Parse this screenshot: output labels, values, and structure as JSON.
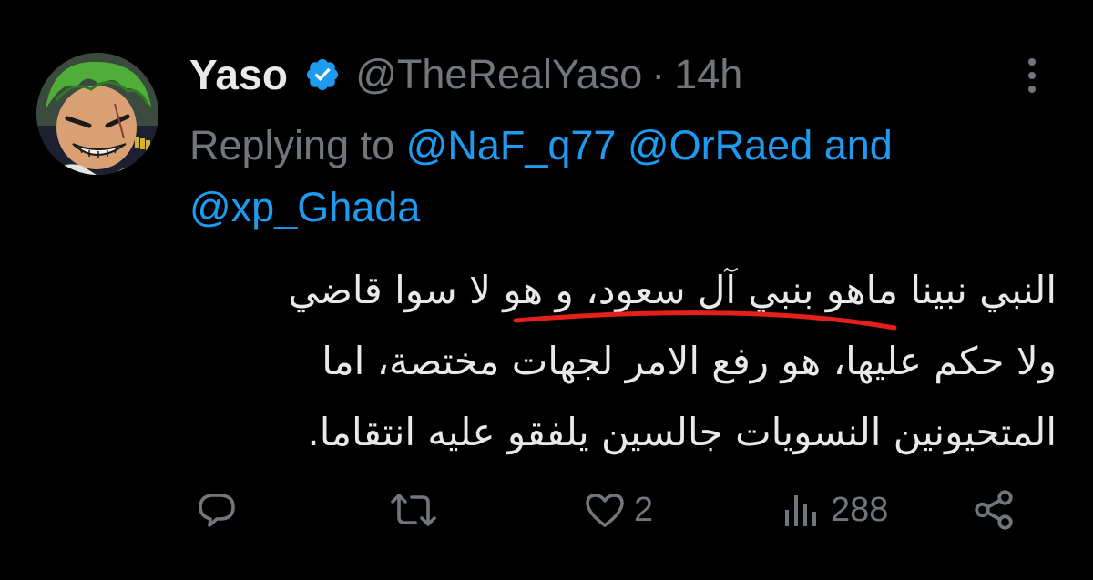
{
  "tweet": {
    "author": {
      "display_name": "Yaso",
      "handle": "@TheRealYaso",
      "time": "14h",
      "separator": "·",
      "verified": true,
      "avatar_icon": "avatar-anime-character"
    },
    "reply": {
      "prefix": "Replying to",
      "mention_1": "@NaF_q77",
      "mention_2": "@OrRaed",
      "and": "and",
      "mention_3": "@xp_Ghada"
    },
    "body": {
      "line_1": "النبي نبينا ماهو بنبي آل سعود، و هو لا سوا قاضي",
      "line_2": "ولا حكم عليها، هو رفع الامر لجهات مختصة، اما",
      "line_3": "المتحيونين النسويات جالسين يلفقو عليه انتقاما."
    },
    "actions": {
      "reply_icon": "reply-icon",
      "retweet_icon": "retweet-icon",
      "like_icon": "heart-icon",
      "like_count": "2",
      "views_icon": "analytics-icon",
      "views_count": "288",
      "share_icon": "share-icon"
    },
    "colors": {
      "background": "#000000",
      "text_primary": "#e7e9ea",
      "text_secondary": "#71767b",
      "accent": "#1d9bf0",
      "verified_badge": "#1d9bf0",
      "annotation_mark": "#e3201b"
    }
  }
}
